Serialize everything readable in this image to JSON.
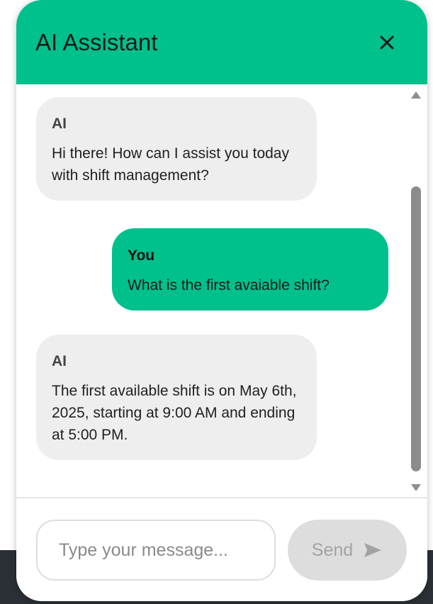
{
  "header": {
    "title": "AI Assistant",
    "close_icon": "close-icon"
  },
  "messages": [
    {
      "role": "ai",
      "sender": "AI",
      "text": "Hi there! How can I assist you today with shift management?"
    },
    {
      "role": "user",
      "sender": "You",
      "text": "What is the first avaiable shift?"
    },
    {
      "role": "ai",
      "sender": "AI",
      "text": "The first available shift is on May 6th, 2025, starting at 9:00 AM and ending at 5:00 PM."
    }
  ],
  "composer": {
    "placeholder": "Type your message...",
    "value": "",
    "send_label": "Send",
    "send_icon": "send-arrow-icon"
  },
  "colors": {
    "accent": "#00c08b",
    "ai_bubble": "#eeeeee",
    "send_disabled": "#dddddd",
    "backdrop": "#2b3036"
  }
}
